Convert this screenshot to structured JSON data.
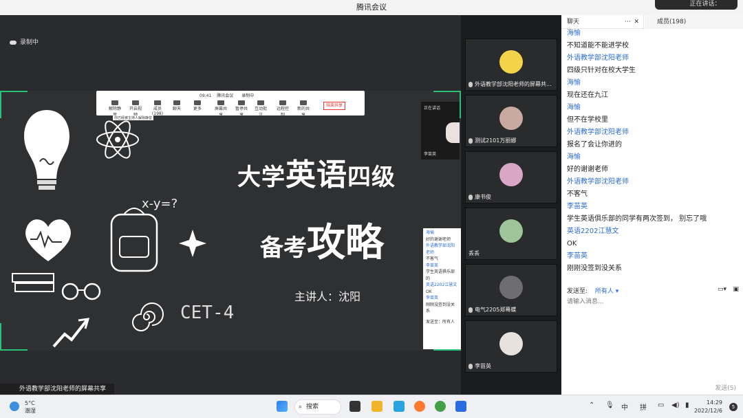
{
  "window": {
    "title": "腾讯会议",
    "speaking": "正在讲话："
  },
  "stage": {
    "recording": "录制中",
    "presenter_label": "外语教学部沈阳老师的屏幕共享"
  },
  "slide": {
    "title_a": "大学",
    "title_b": "英语",
    "title_c": "四级",
    "title_d": "备考",
    "title_e": "攻略",
    "speaker": "主讲人：沈阳",
    "cet": "CET-4"
  },
  "mini_toolbar": {
    "time": "09:41",
    "meeting": "腾讯会议",
    "rec": "录制中",
    "buttons": [
      "解除静音",
      "开启视频",
      "成员(198)",
      "聊天",
      "更多",
      "屏幕共享",
      "暂停共享",
      "互动批注",
      "远程控制",
      "新的共享"
    ],
    "end_share": "结束共享",
    "tooltip": "你已经被主持人解除静音"
  },
  "mini_video": {
    "status": "正在讲话",
    "name": "李苗英"
  },
  "mini_chat": [
    "海愉",
    "好的谢谢老师",
    "外语教学部沈阳老师",
    "不客气",
    "李苗英",
    "学生英语俱乐部的",
    "英语2202江慧文",
    "OK",
    "李苗英",
    "刚刚没签到没关系",
    "发送至：所有人"
  ],
  "videos": [
    {
      "name": "外语教学部沈阳老师的屏幕共...",
      "color": "#f3d34a"
    },
    {
      "name": "测试2101万丽娜",
      "color": "#c9a9a0"
    },
    {
      "name": "康书俊",
      "color": "#d8a7c6"
    },
    {
      "name": "丢丢",
      "color": "#9fc49a"
    },
    {
      "name": "电气2205郑蓦蝶",
      "color": "#6e6e70"
    },
    {
      "name": "李苗英",
      "color": "#e8e2dc"
    }
  ],
  "chat": {
    "tab_chat": "聊天",
    "tab_members": "成员(198)",
    "messages": [
      {
        "sender": "海愉",
        "text": "不知道能不能进学校"
      },
      {
        "sender": "外语教学部沈阳老师",
        "text": "四级只针对在校大学生"
      },
      {
        "sender": "海愉",
        "text": "现在还在九江"
      },
      {
        "sender": "海愉",
        "text": "但不在学校里"
      },
      {
        "sender": "外语教学部沈阳老师",
        "text": "报名了会让你进的"
      },
      {
        "sender": "海愉",
        "text": "好的谢谢老师"
      },
      {
        "sender": "外语教学部沈阳老师",
        "text": "不客气"
      },
      {
        "sender": "李苗英",
        "text": "学生英语俱乐部的同学有两次签到， 别忘了哦"
      },
      {
        "sender": "英语2202江慧文",
        "text": "OK"
      },
      {
        "sender": "李苗英",
        "text": "刚刚没签到没关系"
      }
    ],
    "send_to_label": "发送至:",
    "send_to_value": "所有人",
    "input_placeholder": "请输入消息...",
    "send_button": "发送(S)"
  },
  "taskbar": {
    "temp": "5°C",
    "weather": "潮湿",
    "search": "搜索",
    "ime_1": "中",
    "ime_2": "拼",
    "time": "14:29",
    "date": "2022/12/6",
    "notif": "5"
  }
}
